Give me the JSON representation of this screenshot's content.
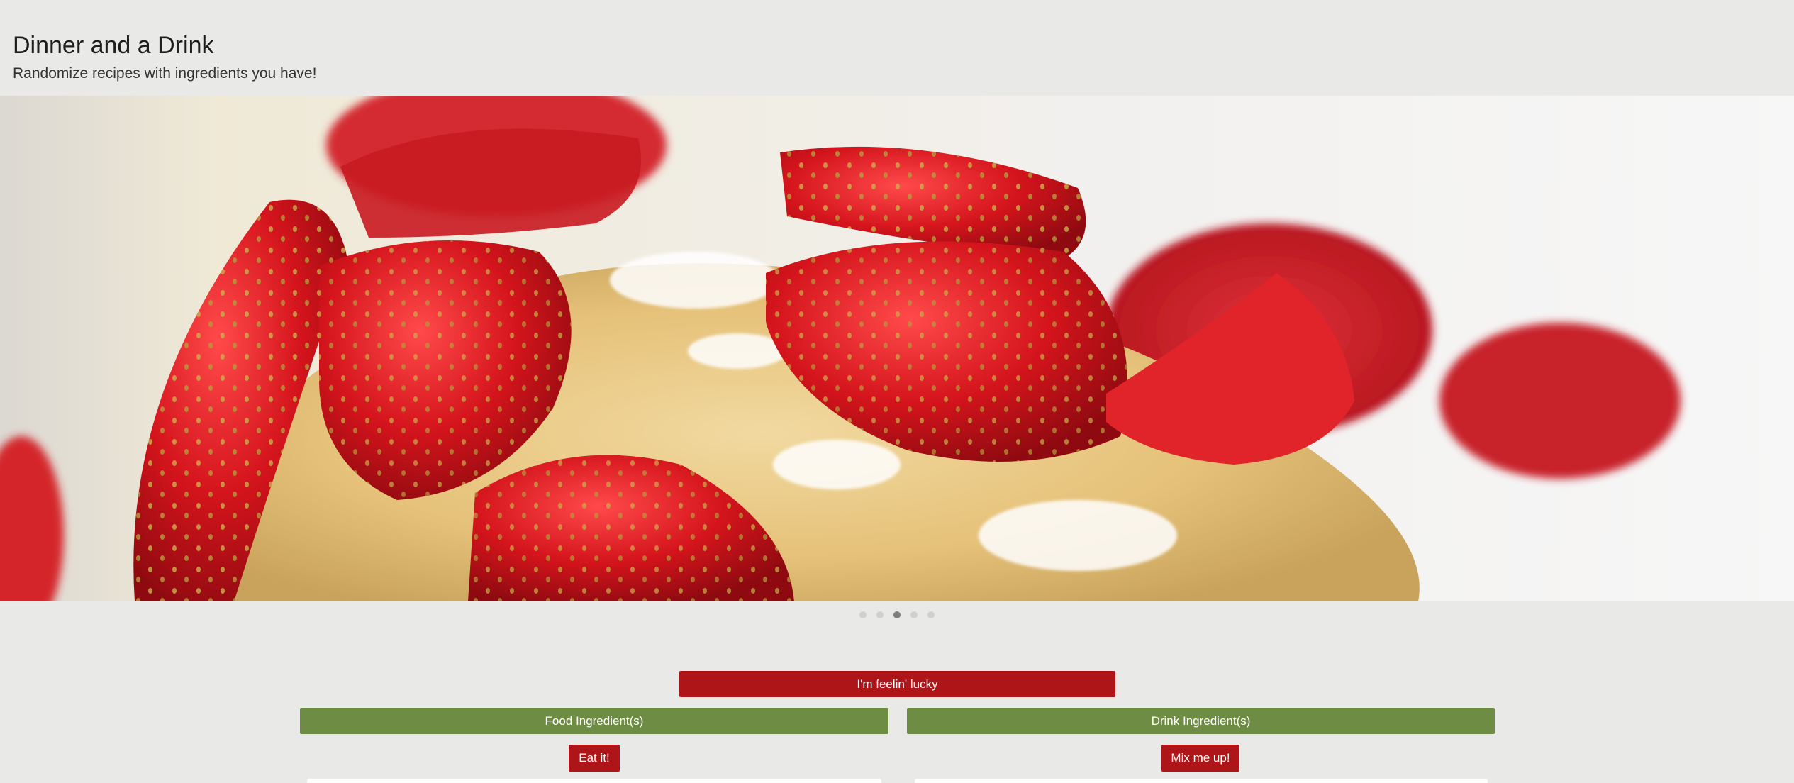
{
  "header": {
    "title": "Dinner and a Drink",
    "tagline": "Randomize recipes with ingredients you have!"
  },
  "carousel": {
    "slide_count": 5,
    "active_index": 2,
    "image_subject": "crepe topped with sliced strawberries and powdered sugar"
  },
  "buttons": {
    "lucky": "I'm feelin' lucky",
    "food_ingredients": "Food Ingredient(s)",
    "drink_ingredients": "Drink Ingredient(s)",
    "eat": "Eat it!",
    "mix": "Mix me up!"
  },
  "colors": {
    "background": "#e9e9e7",
    "accent_red": "#ad1519",
    "accent_green": "#6f8c45",
    "dot_inactive": "#d0d0ce",
    "dot_active": "#7c7f7d"
  }
}
